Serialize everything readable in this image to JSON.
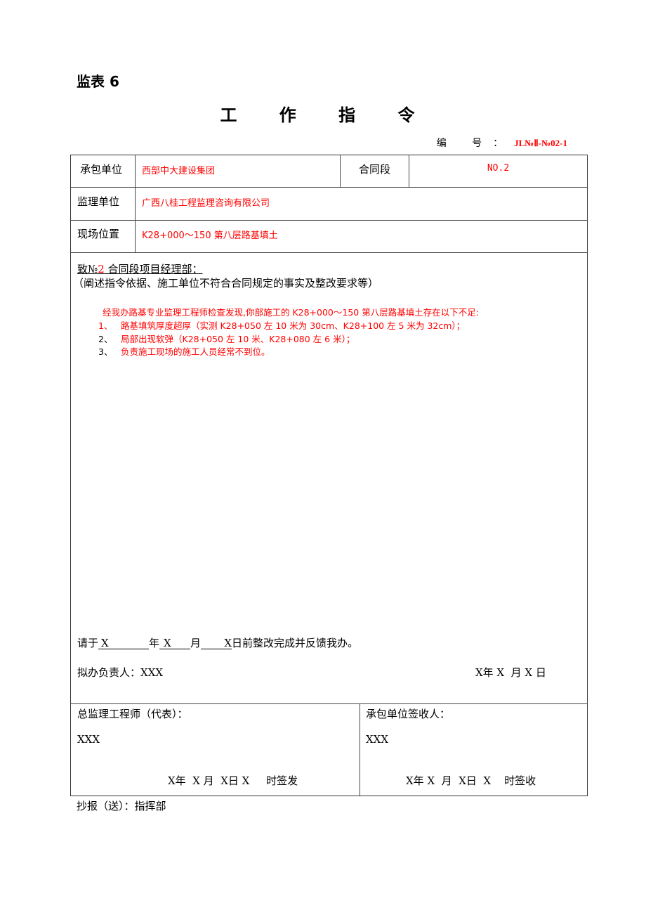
{
  "header": {
    "form_code": "监表 6",
    "title": "工 作 指 令",
    "serial_label": "编 号：",
    "serial_value": "JL№Ⅱ-№02-1"
  },
  "info_table": {
    "contractor_label": "承包单位",
    "contractor_value": "西部中大建设集团",
    "contract_section_label": "合同段",
    "contract_section_value": "NO.2",
    "supervisor_label": "监理单位",
    "supervisor_value": "广西八桂工程监理咨询有限公司",
    "location_label": "现场位置",
    "location_value": "K28+000～150 第八层路基填土"
  },
  "instruction": {
    "addressee_prefix": "致№",
    "addressee_number": "2",
    "addressee_suffix": " 合同段项目经理部：",
    "hint": "（阐述指令依据、施工单位不符合合同规定的事实及整改要求等）",
    "intro": "经我办路基专业监理工程师检查发现,你部施工的 K28+000～150 第八层路基填土存在以下不足:",
    "items": [
      {
        "num": "1、",
        "text": "路基填筑厚度超厚（实测 K28+050 左 10 米为 30cm、K28+100 左 5 米为 32cm）；"
      },
      {
        "num": "2、",
        "text": "局部出现软弹（K28+050 左 10 米、K28+080 左 6 米）；"
      },
      {
        "num": "3、",
        "text": "负责施工现场的施工人员经常不到位。"
      }
    ],
    "deadline": {
      "prefix": "请于",
      "year": "X",
      "year_unit": "年",
      "month": "X",
      "month_unit": "月",
      "day": "X",
      "suffix": "日前整改完成并反馈我办。"
    },
    "handler_label": "拟办负责人：",
    "handler_value": "XXX",
    "date": "X年 X  月 X 日"
  },
  "signatures": {
    "chief_label": "总监理工程师（代表）：",
    "chief_name": "XXX",
    "chief_datetime": "X年  X 月  X日 X     时签发",
    "receiver_label": "承包单位签收人：",
    "receiver_name": "XXX",
    "receiver_datetime": "X年 X  月  X日  X    时签收"
  },
  "footer": {
    "cc": "抄报（送）：指挥部"
  }
}
